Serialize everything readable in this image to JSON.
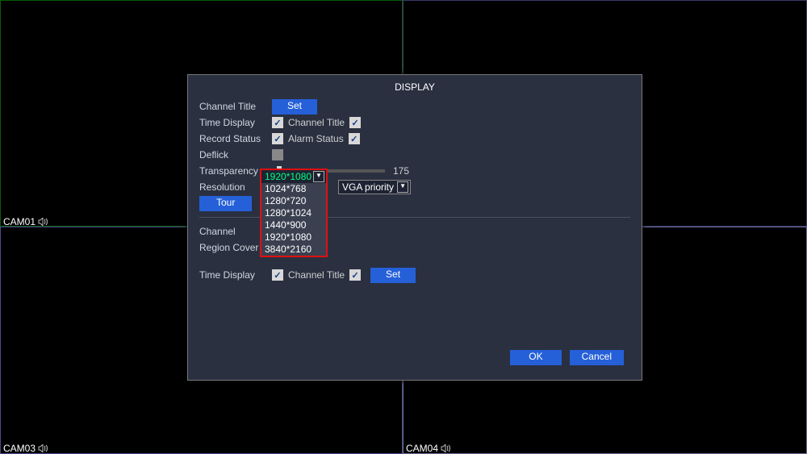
{
  "cameras": {
    "c1": "CAM01",
    "c3": "CAM03",
    "c4": "CAM04"
  },
  "dialog": {
    "title": "DISPLAY",
    "rows": {
      "channel_title": "Channel Title",
      "set": "Set",
      "time_display": "Time Display",
      "channel_title2": "Channel Title",
      "record_status": "Record Status",
      "alarm_status": "Alarm Status",
      "deflick": "Deflick",
      "transparency": "Transparency",
      "transparency_val": "175",
      "resolution": "Resolution",
      "vga_priority": "VGA priority",
      "tour": "Tour",
      "channel": "Channel",
      "region_cover": "Region Cover",
      "time_display2": "Time Display",
      "channel_title3": "Channel Title",
      "set2": "Set",
      "ok": "OK",
      "cancel": "Cancel"
    },
    "resolution_select": {
      "selected": "1920*1080",
      "options": [
        "1024*768",
        "1280*720",
        "1280*1024",
        "1440*900",
        "1920*1080",
        "3840*2160"
      ]
    }
  }
}
